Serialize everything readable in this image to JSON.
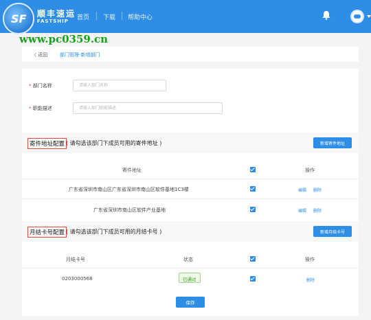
{
  "header": {
    "logo_mark": "SF",
    "brand_cn": "顺丰速运",
    "brand_en": "FASTSHIP",
    "nav": [
      "首页",
      "下载",
      "帮助中心"
    ],
    "bell_icon": "bell-icon",
    "avatar_icon": "user-avatar-icon"
  },
  "watermark": "www.pc0359.cn",
  "breadcrumb": {
    "back": "〈  返回",
    "path": "部门管理-新增部门"
  },
  "form": {
    "dept_name_label": "部门名称",
    "dept_name_placeholder": "请输入部门名称",
    "dept_duty_label": "职能描述",
    "dept_duty_placeholder": "请输入部门职能描述",
    "required_mark": "*"
  },
  "address_section": {
    "title": "寄件地址配置",
    "hint": "( 请勾选该部门下成员可用的寄件地址 )",
    "add_button": "新增寄件地址",
    "columns": [
      "寄件地址",
      "操作"
    ],
    "rows": [
      {
        "address": "广东省深圳市南山区广东省深圳市南山区软件基地1C3楼",
        "checked": true,
        "edit": "编辑",
        "delete": "删除"
      },
      {
        "address": "广东省深圳市南山区软件产业基地",
        "checked": true,
        "edit": "编辑",
        "delete": "删除"
      }
    ]
  },
  "card_section": {
    "title": "月结卡号配置",
    "hint": "( 请勾选该部门下成员可用的月结卡号 )",
    "add_button": "新增月结卡号",
    "columns": [
      "月结卡号",
      "状态",
      "操作"
    ],
    "rows": [
      {
        "card": "0203000568",
        "status": "已通过",
        "checked": true,
        "delete": "删除"
      }
    ]
  },
  "save_button": "保存",
  "colors": {
    "primary": "#2e8ee6",
    "highlight_border": "#e04b3a",
    "watermark": "#19a019"
  }
}
